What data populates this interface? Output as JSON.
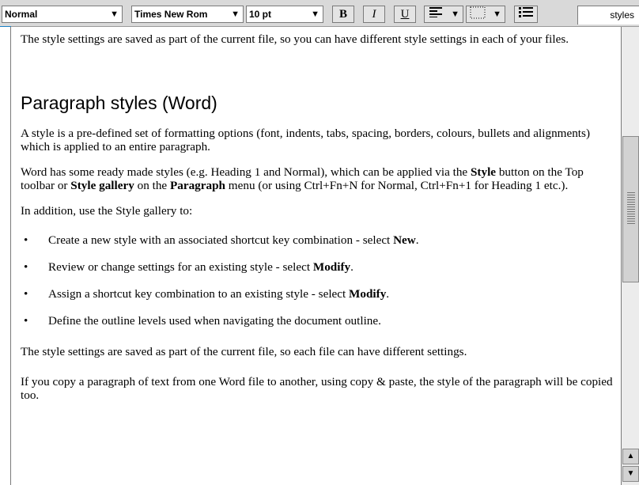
{
  "toolbar": {
    "style_select": "Normal",
    "font_select": "Times New Rom",
    "size_select": "10 pt",
    "bold_label": "B",
    "italic_label": "I",
    "underline_label": "U",
    "align_icon": "align-left-icon",
    "border_icon": "border-icon",
    "list_icon": "bullet-list-icon",
    "styles_tab": "styles"
  },
  "doc": {
    "lead": "The style settings are saved as part of the current file, so you can have different style settings in each of your files.",
    "heading": "Paragraph styles (Word)",
    "para1": "A style is a pre-defined set of formatting options (font, indents, tabs, spacing, borders, colours, bullets and alignments) which is applied to an entire paragraph.",
    "para2": {
      "t1": "Word has some ready made styles (e.g. Heading 1 and Normal), which can be applied via the ",
      "b1": "Style",
      "t2": " button on the Top toolbar or ",
      "b2": "Style gallery",
      "t3": " on the ",
      "b3": "Paragraph",
      "t4": " menu (or using Ctrl+Fn+N for Normal, Ctrl+Fn+1 for Heading 1 etc.)."
    },
    "para3": "In addition, use the Style gallery to:",
    "bullets": [
      {
        "text": "Create a new style with an associated shortcut key combination - select ",
        "bold": "New",
        "end": "."
      },
      {
        "text": "Review or change settings for an existing style - select ",
        "bold": "Modify",
        "end": "."
      },
      {
        "text": "Assign a shortcut key combination to an existing style - select ",
        "bold": "Modify",
        "end": "."
      },
      {
        "text": "Define the outline levels used when navigating the document outline.",
        "bold": "",
        "end": ""
      }
    ],
    "para4": "The style settings are saved as part of the current file, so each file can have different settings.",
    "para5": "If you copy a paragraph of text from one Word file to another, using copy & paste, the style of the paragraph will be copied too."
  }
}
